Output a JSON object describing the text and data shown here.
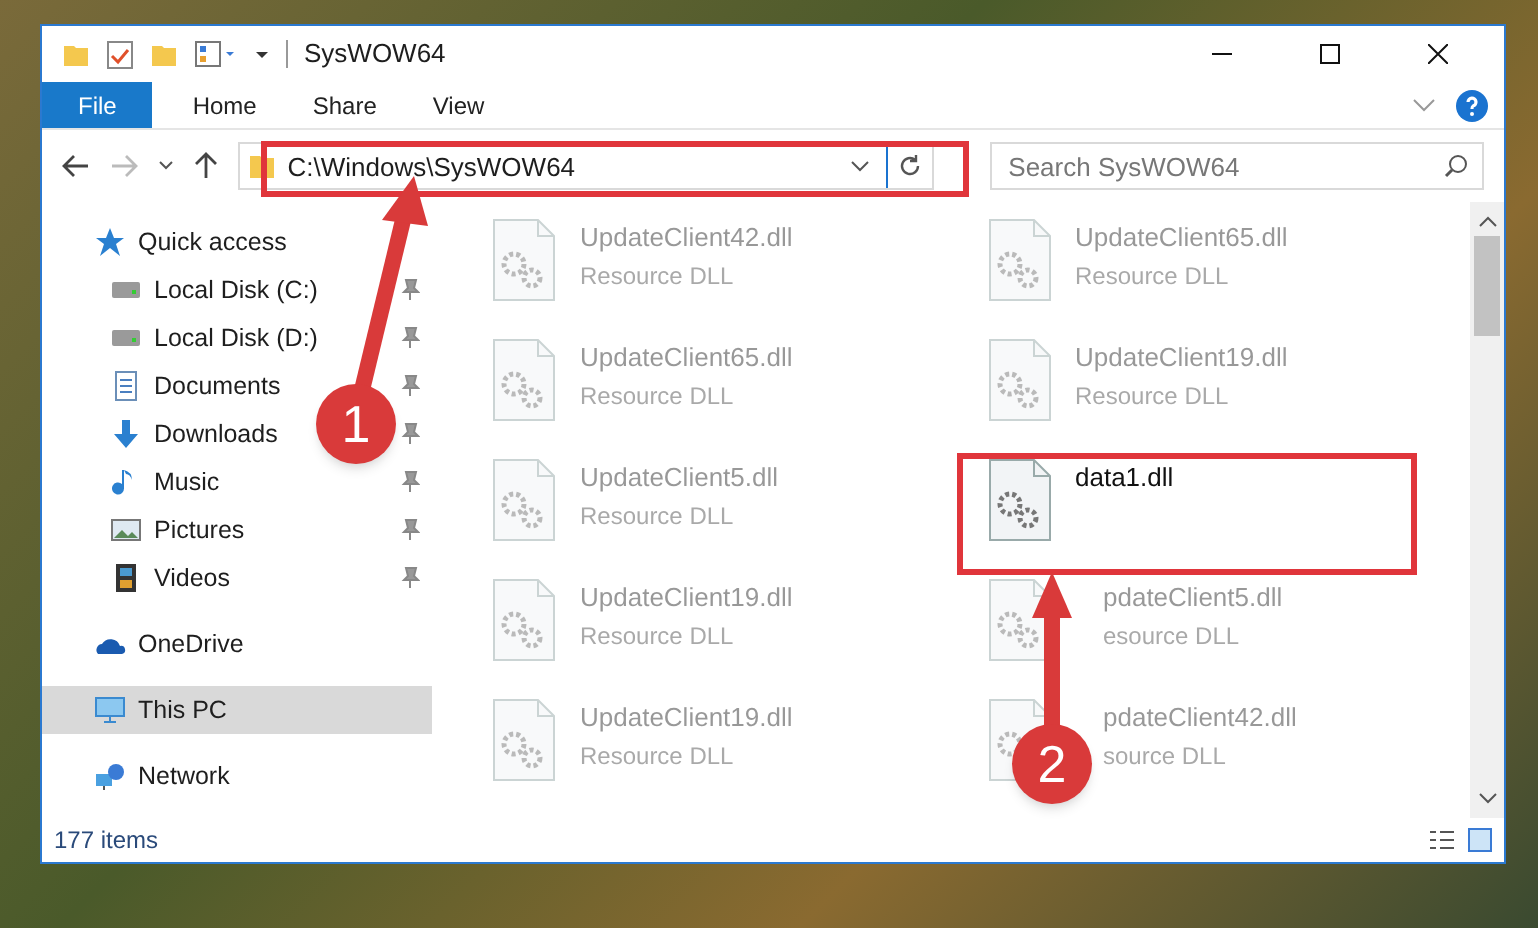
{
  "window": {
    "title": "SysWOW64"
  },
  "ribbon_tabs": [
    {
      "label": "File",
      "selected": true
    },
    {
      "label": "Home",
      "selected": false
    },
    {
      "label": "Share",
      "selected": false
    },
    {
      "label": "View",
      "selected": false
    }
  ],
  "address": {
    "path": "C:\\Windows\\SysWOW64"
  },
  "search": {
    "placeholder": "Search SysWOW64"
  },
  "sidebar": {
    "items": [
      {
        "label": "Quick access",
        "kind": "star",
        "selected": false,
        "children": [
          {
            "label": "Local Disk (C:)",
            "kind": "drive",
            "pinned": true
          },
          {
            "label": "Local Disk (D:)",
            "kind": "drive",
            "pinned": true
          },
          {
            "label": "Documents",
            "kind": "document",
            "pinned": true
          },
          {
            "label": "Downloads",
            "kind": "download",
            "pinned": true
          },
          {
            "label": "Music",
            "kind": "music",
            "pinned": true
          },
          {
            "label": "Pictures",
            "kind": "picture",
            "pinned": true
          },
          {
            "label": "Videos",
            "kind": "video",
            "pinned": true
          }
        ]
      },
      {
        "label": "OneDrive",
        "kind": "cloud",
        "selected": false
      },
      {
        "label": "This PC",
        "kind": "pc",
        "selected": true
      },
      {
        "label": "Network",
        "kind": "network",
        "selected": false
      }
    ]
  },
  "files": [
    {
      "name": "UpdateClient42.dll",
      "type": "Resource DLL",
      "blurred": true
    },
    {
      "name": "UpdateClient65.dll",
      "type": "Resource DLL",
      "blurred": true
    },
    {
      "name": "UpdateClient65.dll",
      "type": "Resource DLL",
      "blurred": true
    },
    {
      "name": "UpdateClient19.dll",
      "type": "Resource DLL",
      "blurred": true
    },
    {
      "name": "UpdateClient5.dll",
      "type": "Resource DLL",
      "blurred": true
    },
    {
      "name": "data1.dll",
      "blurred": false
    },
    {
      "name": "UpdateClient19.dll",
      "type": "Resource DLL",
      "blurred": true
    },
    {
      "name": "pdateClient5.dll",
      "type": "esource DLL",
      "blurred": true,
      "covered": true
    },
    {
      "name": "UpdateClient19.dll",
      "type": "Resource DLL",
      "blurred": true
    },
    {
      "name": "pdateClient42.dll",
      "type": "source DLL",
      "blurred": true,
      "covered": true
    }
  ],
  "status_bar": {
    "count": "177 items"
  },
  "callouts": [
    {
      "label": "1"
    },
    {
      "label": "2"
    }
  ]
}
